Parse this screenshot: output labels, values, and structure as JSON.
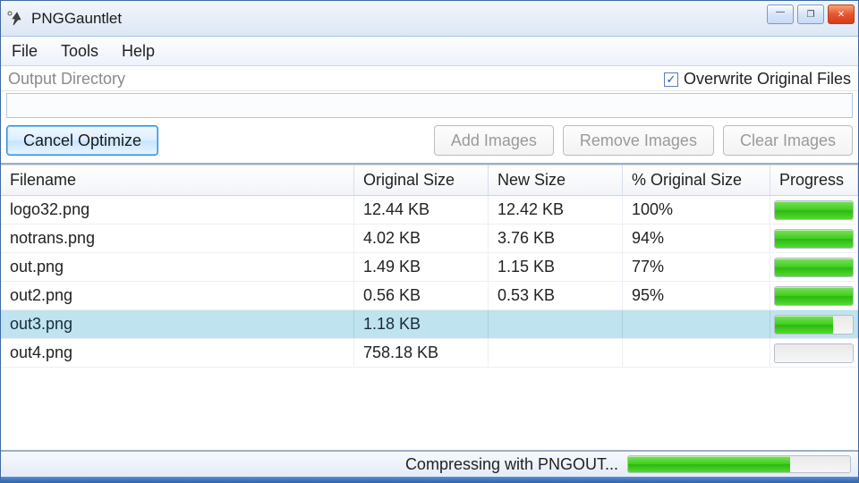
{
  "app": {
    "title": "PNGGauntlet"
  },
  "window_controls": {
    "minimize": "—",
    "maximize": "❐",
    "close": "✕"
  },
  "menu": {
    "file": "File",
    "tools": "Tools",
    "help": "Help"
  },
  "output": {
    "label": "Output Directory",
    "path": "",
    "overwrite_label": "Overwrite Original Files",
    "overwrite_checked": true
  },
  "toolbar": {
    "cancel": "Cancel Optimize",
    "add": "Add Images",
    "remove": "Remove Images",
    "clear": "Clear Images"
  },
  "table": {
    "columns": {
      "filename": "Filename",
      "original": "Original Size",
      "newsize": "New Size",
      "pct": "% Original Size",
      "progress": "Progress"
    },
    "rows": [
      {
        "filename": "logo32.png",
        "original": "12.44 KB",
        "newsize": "12.42 KB",
        "pct": "100%",
        "progress": 100,
        "selected": false
      },
      {
        "filename": "notrans.png",
        "original": "4.02 KB",
        "newsize": "3.76 KB",
        "pct": "94%",
        "progress": 100,
        "selected": false
      },
      {
        "filename": "out.png",
        "original": "1.49 KB",
        "newsize": "1.15 KB",
        "pct": "77%",
        "progress": 100,
        "selected": false
      },
      {
        "filename": "out2.png",
        "original": "0.56 KB",
        "newsize": "0.53 KB",
        "pct": "95%",
        "progress": 100,
        "selected": false
      },
      {
        "filename": "out3.png",
        "original": "1.18 KB",
        "newsize": "",
        "pct": "",
        "progress": 75,
        "selected": true
      },
      {
        "filename": "out4.png",
        "original": "758.18 KB",
        "newsize": "",
        "pct": "",
        "progress": 0,
        "selected": false
      }
    ]
  },
  "status": {
    "text": "Compressing with PNGOUT...",
    "progress": 73
  }
}
